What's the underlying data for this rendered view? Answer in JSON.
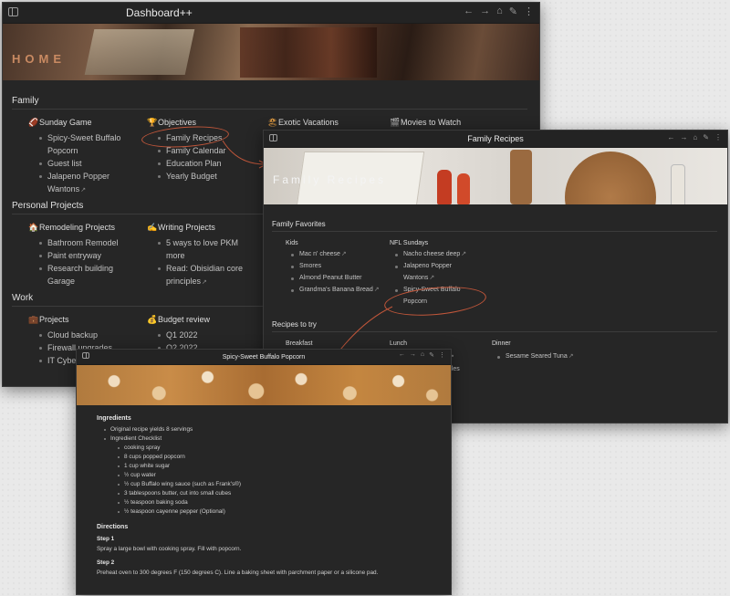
{
  "win1": {
    "title": "Dashboard++",
    "banner_title": "HOME",
    "sections": {
      "family": "Family",
      "personal": "Personal Projects",
      "work": "Work"
    },
    "family_cols": [
      {
        "head": "Sunday Game",
        "items": [
          "Spicy-Sweet Buffalo Popcorn",
          "Guest list",
          "Jalapeno Popper Wantons"
        ]
      },
      {
        "head": "Objectives",
        "items": [
          "Family Recipes",
          "Family Calendar",
          "Education Plan",
          "Yearly Budget"
        ]
      },
      {
        "head": "Exotic Vacations",
        "items": []
      },
      {
        "head": "Movies to Watch",
        "items": []
      }
    ],
    "personal_cols": [
      {
        "head": "Remodeling Projects",
        "items": [
          "Bathroom Remodel",
          "Paint entryway",
          "Research building Garage"
        ]
      },
      {
        "head": "Writing Projects",
        "items": [
          "5 ways to love PKM more",
          "Read: Obisidian core principles"
        ]
      }
    ],
    "work_cols": [
      {
        "head": "Projects",
        "items": [
          "Cloud backup",
          "Firewall upgrades",
          "IT Cybers"
        ]
      },
      {
        "head": "Budget review",
        "items": [
          "Q1 2022",
          "Q2 2022"
        ]
      }
    ]
  },
  "win2": {
    "title": "Family Recipes",
    "banner_title": "Family Recipes",
    "favorites": "Family Favorites",
    "try": "Recipes to try",
    "kids_head": "Kids",
    "kids": [
      "Mac n' cheese",
      "Smores",
      "Almond Peanut Butter",
      "Grandma's Banana Bread"
    ],
    "nfl_head": "NFL Sundays",
    "nfl": [
      "Nacho cheese deep",
      "Jalapeno Popper Wantons",
      "Spicy-Sweet Buffalo Popcorn"
    ],
    "breakfast": "Breakfast",
    "lunch": "Lunch",
    "dinner": "Dinner",
    "dinner_items": [
      "Sesame Seared Tuna"
    ],
    "lunch_fragments": [
      "d",
      "odles"
    ]
  },
  "win3": {
    "title": "Spicy-Sweet Buffalo Popcorn",
    "ingredients_h": "Ingredients",
    "yield": "Original recipe yields 8 servings",
    "checklist": "Ingredient Checklist",
    "ingredients": [
      "cooking spray",
      "8 cups popped popcorn",
      "1 cup white sugar",
      "½ cup water",
      "½ cup Buffalo wing sauce (such as Frank's®)",
      "3 tablespoons butter, cut into small cubes",
      "½ teaspoon baking soda",
      "½ teaspoon cayenne pepper (Optional)"
    ],
    "directions_h": "Directions",
    "step1_h": "Step 1",
    "step1": "Spray a large bowl with cooking spray. Fill with popcorn.",
    "step2_h": "Step 2",
    "step2": "Preheat oven to 300 degrees F (150 degrees C). Line a baking sheet with parchment paper or a silicone pad."
  },
  "tool_icons": [
    "back-arrow-icon",
    "forward-arrow-icon",
    "home-icon",
    "edit-icon",
    "more-icon"
  ],
  "colors": {
    "window_bg": "#262626",
    "accent_circle": "#c0563a",
    "text": "#d4d4d4"
  }
}
